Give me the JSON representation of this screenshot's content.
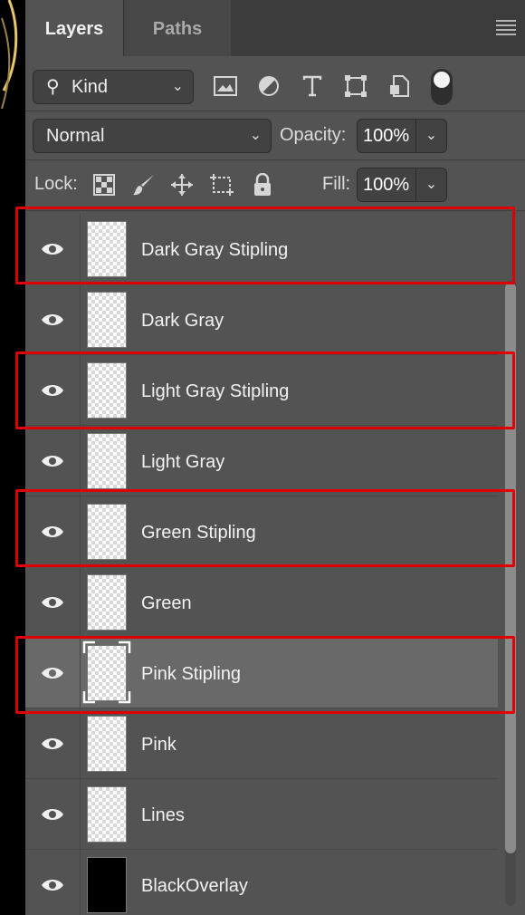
{
  "tabs": [
    {
      "label": "Layers",
      "active": true
    },
    {
      "label": "Paths",
      "active": false
    }
  ],
  "filter": {
    "kind_label": "Kind",
    "icons": [
      "image-filter-icon",
      "adjustment-filter-icon",
      "type-filter-icon",
      "shape-filter-icon",
      "smart-object-filter-icon"
    ]
  },
  "blend": {
    "mode": "Normal",
    "opacity_label": "Opacity:",
    "opacity_value": "100%"
  },
  "lock": {
    "label": "Lock:",
    "fill_label": "Fill:",
    "fill_value": "100%"
  },
  "layers": [
    {
      "name": "Dark Gray Stipling",
      "visible": true,
      "highlighted": true
    },
    {
      "name": "Dark Gray",
      "visible": true,
      "highlighted": false
    },
    {
      "name": "Light Gray Stipling",
      "visible": true,
      "highlighted": true
    },
    {
      "name": "Light Gray",
      "visible": true,
      "highlighted": false
    },
    {
      "name": "Green Stipling",
      "visible": true,
      "highlighted": true
    },
    {
      "name": "Green",
      "visible": true,
      "highlighted": false
    },
    {
      "name": "Pink Stipling",
      "visible": true,
      "highlighted": true,
      "selected": true
    },
    {
      "name": "Pink",
      "visible": true,
      "highlighted": false
    },
    {
      "name": "Lines",
      "visible": true,
      "highlighted": false
    },
    {
      "name": "BlackOverlay",
      "visible": true,
      "highlighted": false
    }
  ],
  "colors": {
    "panel": "#535353",
    "tabbar": "#3c3c3c",
    "selected_row": "#696969",
    "annotation": "#e00000"
  }
}
